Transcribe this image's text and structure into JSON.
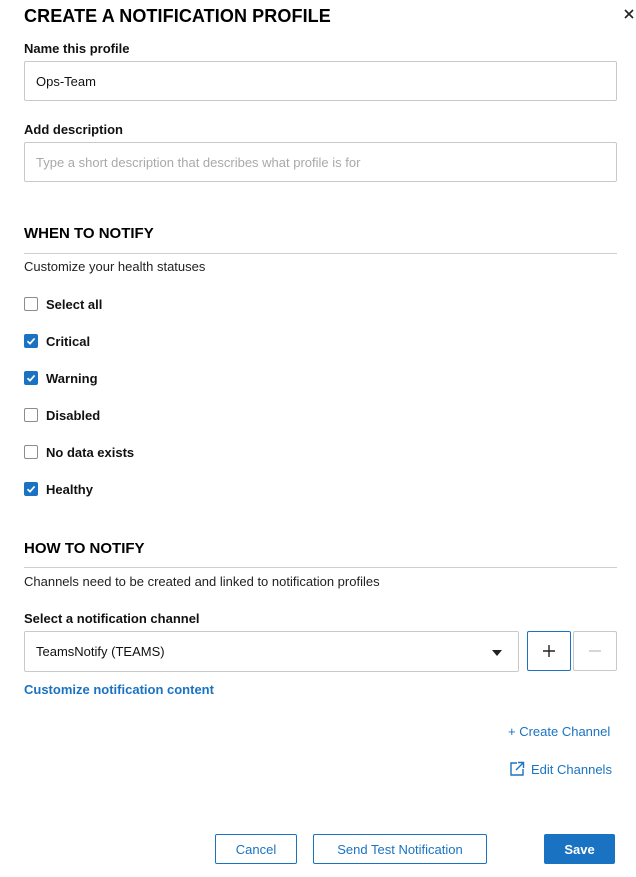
{
  "dialog": {
    "title": "CREATE A NOTIFICATION PROFILE",
    "close_icon": "close-icon"
  },
  "profile": {
    "name_label": "Name this profile",
    "name_value": "Ops-Team",
    "description_label": "Add description",
    "description_value": "",
    "description_placeholder": "Type a short description that describes what profile is for"
  },
  "when": {
    "title": "WHEN TO NOTIFY",
    "subtitle": "Customize your health statuses",
    "options": [
      {
        "label": "Select all",
        "checked": false
      },
      {
        "label": "Critical",
        "checked": true
      },
      {
        "label": "Warning",
        "checked": true
      },
      {
        "label": "Disabled",
        "checked": false
      },
      {
        "label": "No data exists",
        "checked": false
      },
      {
        "label": "Healthy",
        "checked": true
      }
    ]
  },
  "how": {
    "title": "HOW TO NOTIFY",
    "subtitle": "Channels need to be created and linked to notification profiles",
    "channel_label": "Select a notification channel",
    "channel_selected": "TeamsNotify (TEAMS)",
    "add_button_icon": "plus-icon",
    "remove_button_icon": "minus-icon",
    "customize_link": "Customize notification content",
    "create_channel_link": "+ Create Channel",
    "edit_channels_link": "Edit Channels",
    "edit_channels_icon": "external-link-icon"
  },
  "footer": {
    "cancel_label": "Cancel",
    "test_label": "Send Test Notification",
    "save_label": "Save"
  },
  "colors": {
    "accent": "#1a73c2",
    "border": "#c9c9c9"
  }
}
